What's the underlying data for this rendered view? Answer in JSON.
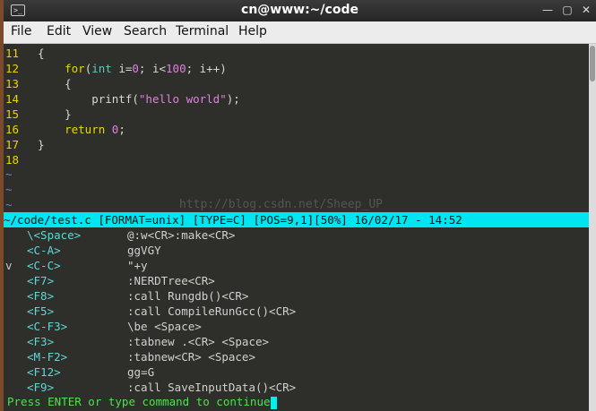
{
  "window": {
    "title": "cn@www:~/code"
  },
  "menu": [
    "File",
    "Edit",
    "View",
    "Search",
    "Terminal",
    "Help"
  ],
  "code": [
    {
      "n": "11",
      "parts": [
        [
          "brace",
          "{"
        ]
      ]
    },
    {
      "n": "12",
      "parts": [
        [
          "punc",
          "    "
        ],
        [
          "kw",
          "for"
        ],
        [
          "punc",
          "("
        ],
        [
          "ty",
          "int"
        ],
        [
          "var",
          " i="
        ],
        [
          "num",
          "0"
        ],
        [
          "var",
          "; i<"
        ],
        [
          "num",
          "100"
        ],
        [
          "var",
          "; i++)"
        ]
      ]
    },
    {
      "n": "13",
      "parts": [
        [
          "brace",
          "    {"
        ]
      ]
    },
    {
      "n": "14",
      "parts": [
        [
          "fn",
          "        printf("
        ],
        [
          "str",
          "\"hello world\""
        ],
        [
          "fn",
          ");"
        ]
      ]
    },
    {
      "n": "15",
      "parts": [
        [
          "brace",
          "    }"
        ]
      ]
    },
    {
      "n": "16",
      "parts": [
        [
          "punc",
          "    "
        ],
        [
          "kw",
          "return"
        ],
        [
          "punc",
          " "
        ],
        [
          "num",
          "0"
        ],
        [
          "punc",
          ";"
        ]
      ]
    },
    {
      "n": "17",
      "parts": [
        [
          "brace",
          "}"
        ]
      ]
    },
    {
      "n": "18",
      "parts": []
    }
  ],
  "tildes": [
    "~",
    "~",
    "~"
  ],
  "watermark": "http://blog.csdn.net/Sheep_UP",
  "statusline": "~/code/test.c [FORMAT=unix] [TYPE=C] [POS=9,1][50%] 16/02/17 - 14:52",
  "mappings": [
    {
      "mode": "",
      "key": "\\<Space>",
      "cmd": "@:w<CR>:make<CR>",
      "keyw": 112
    },
    {
      "mode": "",
      "key": "<C-A>",
      "cmd": "ggVGY",
      "keyw": 112
    },
    {
      "mode": "v",
      "key": "<C-C>",
      "cmd": "\"+y",
      "keyw": 112
    },
    {
      "mode": "",
      "key": "<F7>",
      "cmd": ":NERDTree<CR>",
      "keyw": 112
    },
    {
      "mode": "",
      "key": "<F8>",
      "cmd": ":call Rungdb()<CR>",
      "keyw": 112
    },
    {
      "mode": "",
      "key": "<F5>",
      "cmd": ":call CompileRunGcc()<CR>",
      "keyw": 112
    },
    {
      "mode": "",
      "key": "<C-F3>",
      "cmd": "\\be <Space>",
      "keyw": 112
    },
    {
      "mode": "",
      "key": "<F3>",
      "cmd": ":tabnew .<CR> <Space>",
      "keyw": 112
    },
    {
      "mode": "",
      "key": "<M-F2>",
      "cmd": ":tabnew<CR> <Space>",
      "keyw": 112
    },
    {
      "mode": "",
      "key": "<F12>",
      "cmd": "gg=G",
      "keyw": 112
    },
    {
      "mode": "",
      "key": "<F9>",
      "cmd": ":call SaveInputData()<CR>",
      "keyw": 112
    }
  ],
  "prompt": "Press ENTER or type command to continue"
}
